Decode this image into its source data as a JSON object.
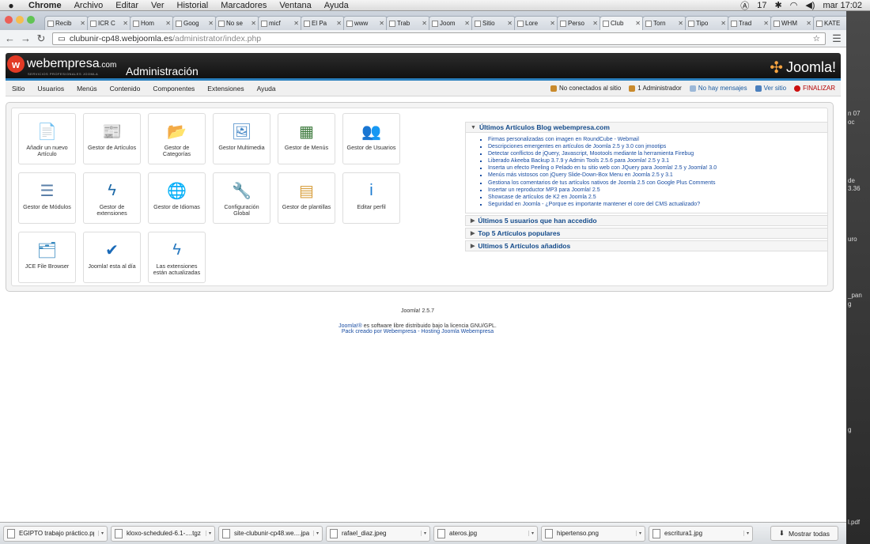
{
  "macbar": {
    "app": "Chrome",
    "menus": [
      "Archivo",
      "Editar",
      "Ver",
      "Historial",
      "Marcadores",
      "Ventana",
      "Ayuda"
    ],
    "clock": "mar 17:02",
    "badge": "17"
  },
  "tabs": [
    {
      "label": "Recib"
    },
    {
      "label": "ICR C"
    },
    {
      "label": "Hom"
    },
    {
      "label": "Goog"
    },
    {
      "label": "No se"
    },
    {
      "label": "micf"
    },
    {
      "label": "El Pa"
    },
    {
      "label": "www"
    },
    {
      "label": "Trab"
    },
    {
      "label": "Joom"
    },
    {
      "label": "Sitio"
    },
    {
      "label": "Lore"
    },
    {
      "label": "Perso"
    },
    {
      "label": "Club"
    },
    {
      "label": "Torn"
    },
    {
      "label": "Tipo"
    },
    {
      "label": "Trad"
    },
    {
      "label": "WHM"
    },
    {
      "label": "KATE"
    }
  ],
  "address": {
    "host": "clubunir-cp48.webjoomla.es",
    "path": "/administrator/index.php"
  },
  "header": {
    "brand": "webempresa",
    "brand_suffix": ".com",
    "brand_sub": "SERVICIOS PROFESIONALES JOOMLA",
    "title": "Administración",
    "joomla": "Joomla!"
  },
  "menu": [
    "Sitio",
    "Usuarios",
    "Menús",
    "Contenido",
    "Componentes",
    "Extensiones",
    "Ayuda"
  ],
  "status": {
    "connected": "No conectados al sitio",
    "admins": "1 Administrador",
    "messages": "No hay mensajes",
    "view_site": "Ver sitio",
    "logout": "FINALIZAR"
  },
  "icons": [
    {
      "label": "Añadir un nuevo Artículo",
      "icon": "add-article-icon",
      "glyph": "📄"
    },
    {
      "label": "Gestor de Artículos",
      "icon": "article-manager-icon",
      "glyph": "📰"
    },
    {
      "label": "Gestor de Categorías",
      "icon": "category-manager-icon",
      "glyph": "📂"
    },
    {
      "label": "Gestor Multimedia",
      "icon": "media-manager-icon",
      "glyph": "🖼"
    },
    {
      "label": "Gestor de Menús",
      "icon": "menu-manager-icon",
      "glyph": "▦"
    },
    {
      "label": "Gestor de Usuarios",
      "icon": "user-manager-icon",
      "glyph": "👥"
    },
    {
      "label": "Gestor de Módulos",
      "icon": "module-manager-icon",
      "glyph": "☰"
    },
    {
      "label": "Gestor de extensiones",
      "icon": "extension-manager-icon",
      "glyph": "ϟ"
    },
    {
      "label": "Gestor de Idiomas",
      "icon": "language-manager-icon",
      "glyph": "🌐"
    },
    {
      "label": "Configuración Global",
      "icon": "global-config-icon",
      "glyph": "🔧"
    },
    {
      "label": "Gestor de plantillas",
      "icon": "template-manager-icon",
      "glyph": "▤"
    },
    {
      "label": "Editar perfil",
      "icon": "edit-profile-icon",
      "glyph": "i"
    },
    {
      "label": "JCE File Browser",
      "icon": "jce-browser-icon",
      "glyph": "🗂"
    },
    {
      "label": "Joomla! esta al día",
      "icon": "joomla-update-icon",
      "glyph": "✔"
    },
    {
      "label": "Las extensiones están actualizadas",
      "icon": "extensions-updated-icon",
      "glyph": "ϟ"
    }
  ],
  "accordion": {
    "blog_title": "Últimos Artículos Blog webempresa.com",
    "blog_items": [
      "Firmas personalizadas con imagen en RoundCube - Webmail",
      "Descripciones emergentes en artículos de Joomla 2.5 y 3.0 con jmootips",
      "Detectar conflictos de jQuery, Javascript, Mootools mediante la herramienta Firebug",
      "Liberado Akeeba Backup 3.7.9 y Admin Tools 2.5.6 para Joomla! 2.5 y 3.1",
      "Inserta un efecto Peeling o Pelado en tu sitio web con JQuery para Joomla! 2.5 y Joomla! 3.0",
      "Menús más vistosos con jQuery Slide-Down-Box Menu en Joomla 2.5 y 3.1",
      "Gestiona los comentarios de tus artículos nativos de Joomla 2.5 con Google Plus Comments",
      "Insertar un reproductor MP3 para Joomla! 2.5",
      "Showcase de artículos de K2 en Joomla 2.5",
      "Seguridad en Joomla - ¿Porque es importante mantener el core del CMS actualizado?"
    ],
    "panes": [
      "Últimos 5 usuarios que han accedido",
      "Top 5 Artículos populares",
      "Ultimos 5 Artículos añadidos"
    ]
  },
  "footer": {
    "version": "Joomla! 2.5.7",
    "license_link": "Joomla!®",
    "license_text": " es software libre distribuido bajo la licencia GNU/GPL.",
    "pack": "Pack creado por Webempresa - Hosting Joomla Webempresa"
  },
  "downloads": [
    "EGIPTO trabajo práctico.ppt",
    "kloxo-scheduled-6.1-....tgz",
    "site-clubunir-cp48.we....jpa",
    "rafael_diaz.jpeg",
    "ateros.jpg",
    "hipertenso.png",
    "escritura1.jpg"
  ],
  "downloads_all": "Mostrar todas",
  "desktop": [
    "n 07",
    "oc",
    "de",
    "3.36",
    "uro",
    "_pan",
    "g",
    "g",
    "l.pdf"
  ]
}
